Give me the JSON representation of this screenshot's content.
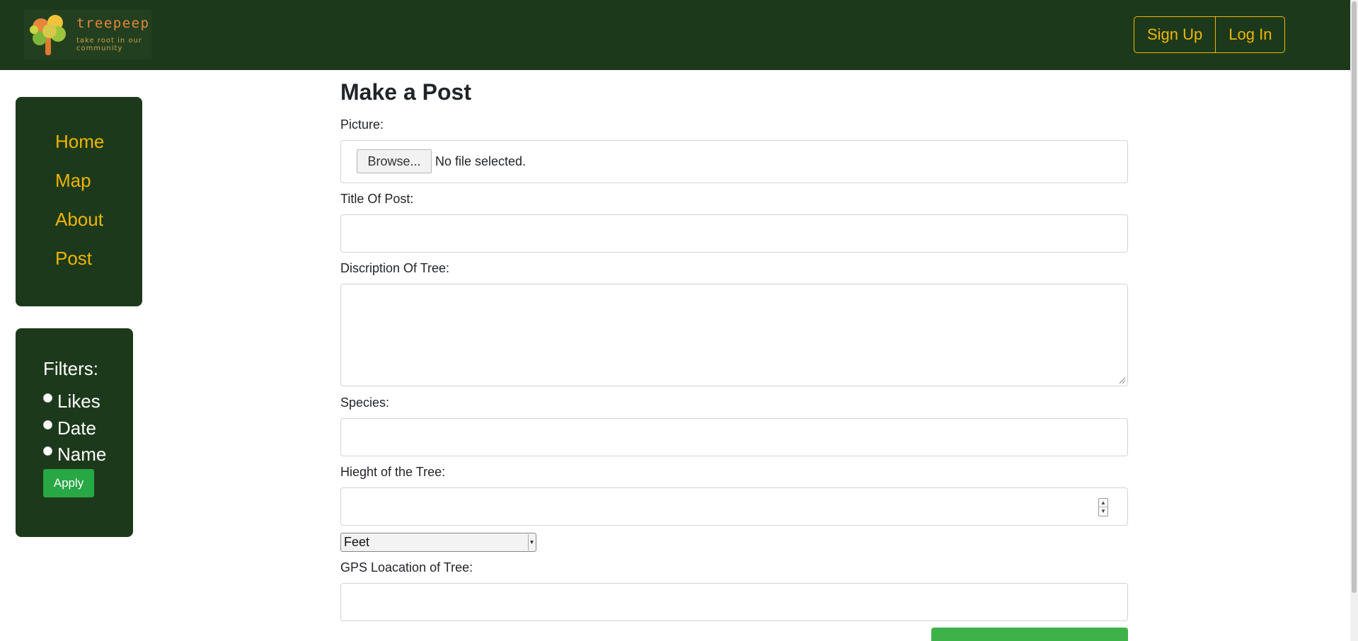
{
  "header": {
    "brand_name": "treepeep",
    "brand_tagline": "take root in our community",
    "signup_label": "Sign Up",
    "login_label": "Log In"
  },
  "sidebar": {
    "items": [
      {
        "label": "Home"
      },
      {
        "label": "Map"
      },
      {
        "label": "About"
      },
      {
        "label": "Post"
      }
    ]
  },
  "filters": {
    "title": "Filters:",
    "options": [
      {
        "label": "Likes",
        "checked": false
      },
      {
        "label": "Date",
        "checked": false
      },
      {
        "label": "Name",
        "checked": false
      }
    ],
    "apply_label": "Apply"
  },
  "form": {
    "title": "Make a Post",
    "picture_label": "Picture:",
    "browse_label": "Browse...",
    "no_file_text": "No file selected.",
    "post_title_label": "Title Of Post:",
    "post_title_value": "",
    "description_label": "Discription Of Tree:",
    "description_value": "",
    "species_label": "Species:",
    "species_value": "",
    "height_label": "Hieght of the Tree:",
    "height_value": "",
    "unit_selected": "Feet",
    "gps_label": "GPS Loacation of Tree:",
    "gps_value": ""
  },
  "colors": {
    "nav_bg": "#1c3a1b",
    "accent_gold": "#f0b400",
    "apply_green": "#28a745",
    "submit_green": "#3db249"
  }
}
